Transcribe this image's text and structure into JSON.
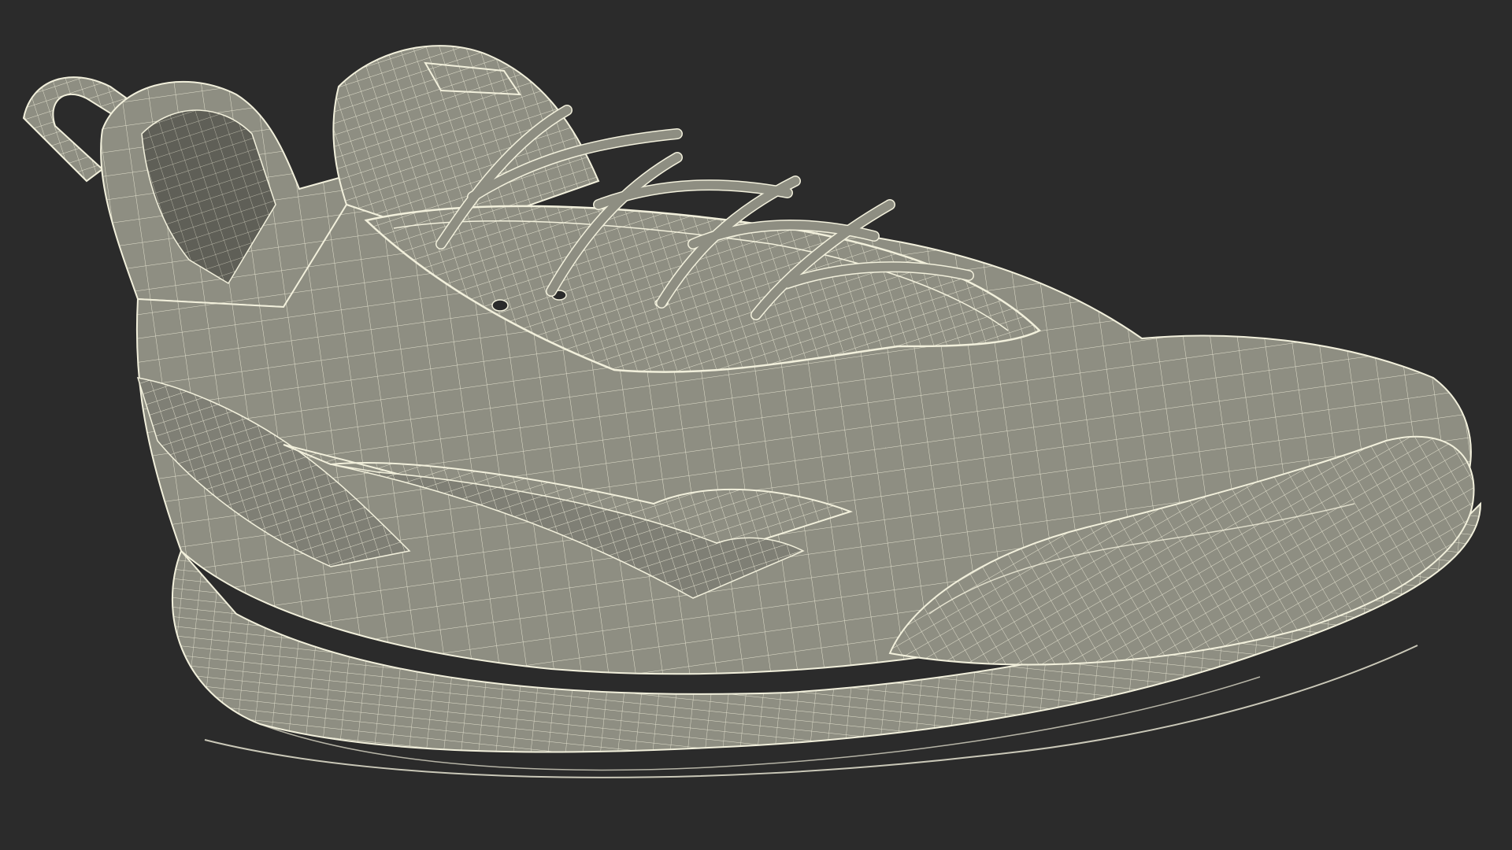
{
  "scene": {
    "subject": "wireframe-sneaker",
    "colors": {
      "background": "#2b2b2b",
      "mesh_fill": "#8e8e82",
      "mesh_fill_dark": "#6f6f65",
      "mesh_fill_inner": "#5f5f57",
      "wire": "#f2f0dc"
    },
    "icons": [
      "wireframe-sneaker-icon"
    ]
  }
}
